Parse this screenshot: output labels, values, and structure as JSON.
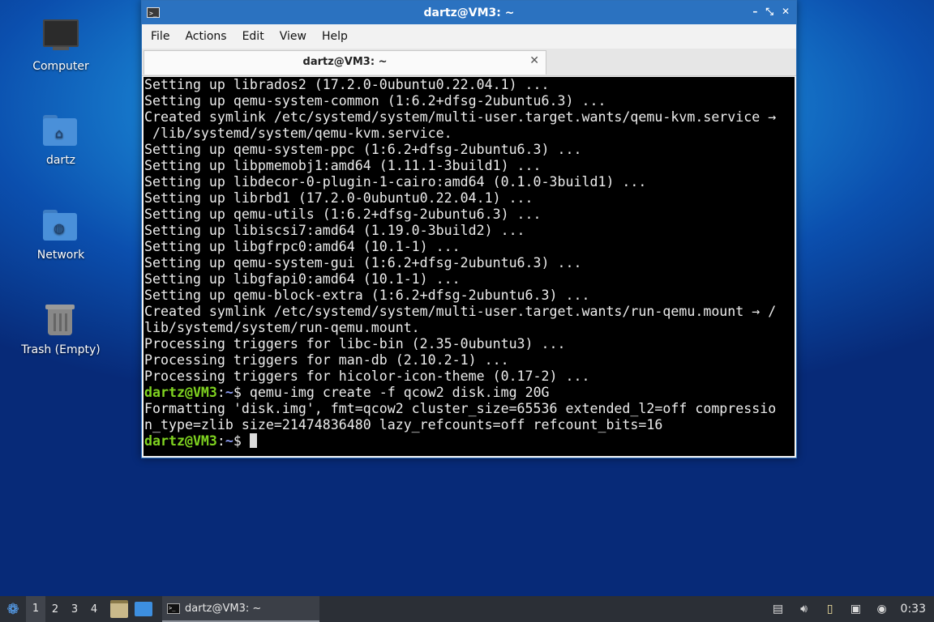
{
  "desktop": {
    "icons": [
      {
        "label": "Computer",
        "icon": "computer-icon"
      },
      {
        "label": "dartz",
        "icon": "home-folder-icon"
      },
      {
        "label": "Network",
        "icon": "network-folder-icon"
      },
      {
        "label": "Trash (Empty)",
        "icon": "trash-icon"
      }
    ]
  },
  "window": {
    "title": "dartz@VM3: ~",
    "controls": {
      "minimize": "–",
      "maximize": "⤡",
      "close": "✕"
    },
    "menu": [
      "File",
      "Actions",
      "Edit",
      "View",
      "Help"
    ],
    "tab": {
      "label": "dartz@VM3: ~",
      "close": "✕"
    },
    "terminal": {
      "lines": [
        "Setting up librados2 (17.2.0-0ubuntu0.22.04.1) ...",
        "Setting up qemu-system-common (1:6.2+dfsg-2ubuntu6.3) ...",
        "Created symlink /etc/systemd/system/multi-user.target.wants/qemu-kvm.service →",
        " /lib/systemd/system/qemu-kvm.service.",
        "Setting up qemu-system-ppc (1:6.2+dfsg-2ubuntu6.3) ...",
        "Setting up libpmemobj1:amd64 (1.11.1-3build1) ...",
        "Setting up libdecor-0-plugin-1-cairo:amd64 (0.1.0-3build1) ...",
        "Setting up librbd1 (17.2.0-0ubuntu0.22.04.1) ...",
        "Setting up qemu-utils (1:6.2+dfsg-2ubuntu6.3) ...",
        "Setting up libiscsi7:amd64 (1.19.0-3build2) ...",
        "Setting up libgfrpc0:amd64 (10.1-1) ...",
        "Setting up qemu-system-gui (1:6.2+dfsg-2ubuntu6.3) ...",
        "Setting up libgfapi0:amd64 (10.1-1) ...",
        "Setting up qemu-block-extra (1:6.2+dfsg-2ubuntu6.3) ...",
        "Created symlink /etc/systemd/system/multi-user.target.wants/run-qemu.mount → /",
        "lib/systemd/system/run-qemu.mount.",
        "Processing triggers for libc-bin (2.35-0ubuntu3) ...",
        "Processing triggers for man-db (2.10.2-1) ...",
        "Processing triggers for hicolor-icon-theme (0.17-2) ..."
      ],
      "prompt_user": "dartz@VM3",
      "prompt_sep": ":",
      "prompt_path": "~",
      "prompt_symbol": "$",
      "command": " qemu-img create -f qcow2 disk.img 20G",
      "output": [
        "Formatting 'disk.img', fmt=qcow2 cluster_size=65536 extended_l2=off compressio",
        "n_type=zlib size=21474836480 lazy_refcounts=off refcount_bits=16"
      ]
    }
  },
  "taskbar": {
    "workspaces": [
      "1",
      "2",
      "3",
      "4"
    ],
    "active_workspace": "1",
    "task_label": "dartz@VM3: ~",
    "clock": "0:33"
  }
}
